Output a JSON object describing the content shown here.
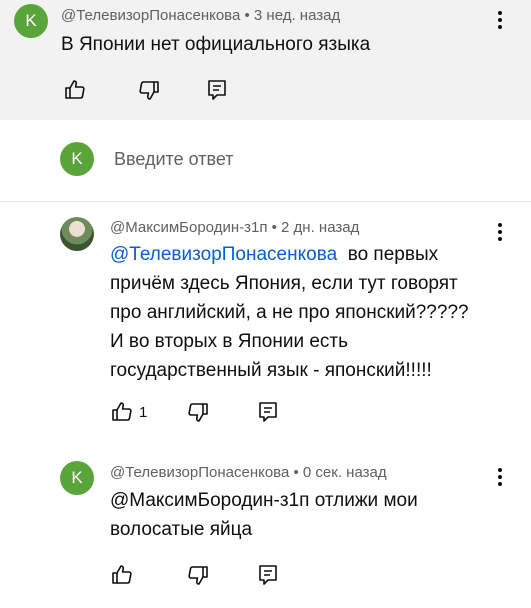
{
  "comments": [
    {
      "avatar_letter": "K",
      "meta": "@ТелевизорПонасенкова • 3 нед. назад",
      "text": "В Японии нет официального языка"
    },
    {
      "meta": "@МаксимБородин-з1п • 2 дн. назад",
      "mention": "@ТелевизорПонасенкова",
      "text_lines": [
        "во первых",
        "причём здесь Япония, если тут говорят",
        "про английский, а не про японский?????",
        "И во вторых в Японии есть",
        "государственный язык - японский!!!!!"
      ],
      "like_count": "1"
    },
    {
      "avatar_letter": "K",
      "meta": "@ТелевизорПонасенкова • 0 сек. назад",
      "text_lines": [
        "@МаксимБородин-з1п отлижи мои",
        "волосатые яйца"
      ]
    }
  ],
  "reply_box": {
    "avatar_letter": "K",
    "placeholder": "Введите ответ"
  },
  "icons": {
    "like": "thumb-up-icon",
    "dislike": "thumb-down-icon",
    "reply": "reply-comment-icon",
    "more": "more-vertical-icon"
  },
  "colors": {
    "avatar_green": "#5aa43c",
    "mention_blue": "#065fd4",
    "highlight_bg": "#f2f2f2"
  }
}
